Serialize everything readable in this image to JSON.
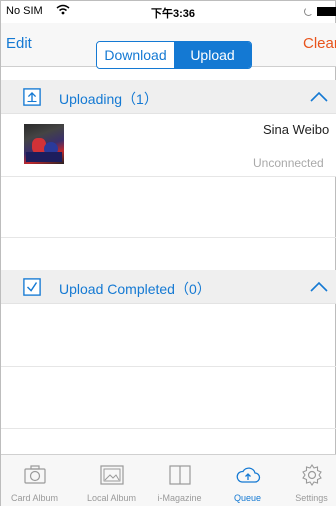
{
  "status_bar": {
    "carrier": "No SIM",
    "time": "下午3:36"
  },
  "nav": {
    "edit": "Edit",
    "segments": [
      "Download",
      "Upload"
    ],
    "selected_segment": "Upload",
    "clear": "Clear"
  },
  "sections": {
    "uploading": {
      "title": "Uploading（1）"
    },
    "completed": {
      "title": "Upload Completed（0）"
    }
  },
  "upload_item": {
    "title": "Sina Weibo",
    "status": "Unconnected"
  },
  "tabbar": {
    "items": [
      {
        "label": "Card Album",
        "icon": "camera-icon"
      },
      {
        "label": "Local Album",
        "icon": "image-icon"
      },
      {
        "label": "i-Magazine",
        "icon": "book-icon"
      },
      {
        "label": "Queue",
        "icon": "cloud-upload-icon"
      },
      {
        "label": "Settings",
        "icon": "gear-icon"
      }
    ],
    "active": "Queue"
  },
  "colors": {
    "accent": "#1479d3",
    "clear": "#e8541c",
    "muted": "#9a9a9a"
  }
}
